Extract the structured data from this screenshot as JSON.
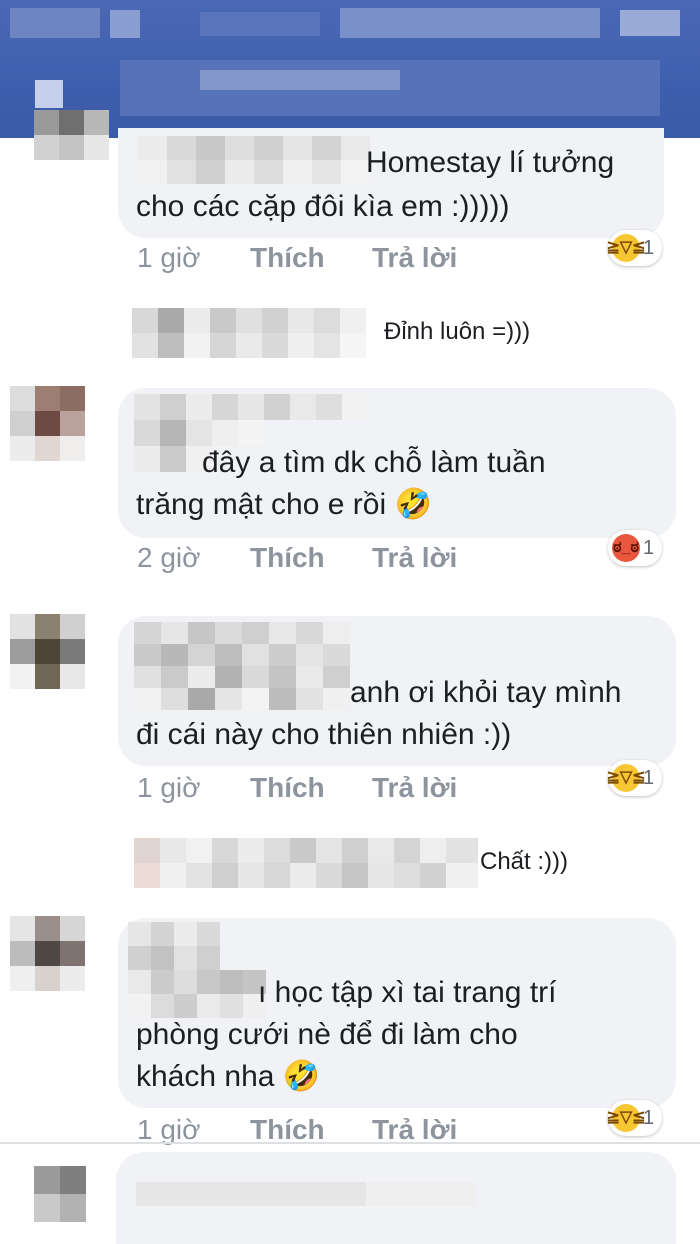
{
  "header": {
    "blurred": true
  },
  "comments": [
    {
      "id": "c1",
      "text_lines": [
        "Homestay lí tưởng",
        "cho các cặp đôi kìa em :)))))"
      ],
      "time": "1 giờ",
      "like_label": "Thích",
      "reply_label": "Trả lời",
      "reaction": {
        "type": "haha",
        "count": "1"
      }
    },
    {
      "id": "r1",
      "text": "Đỉnh luôn =)))"
    },
    {
      "id": "c2",
      "text_lines": [
        "đây a tìm dk chỗ làm tuần",
        "trăng mật cho e rồi 🤣"
      ],
      "time": "2 giờ",
      "like_label": "Thích",
      "reply_label": "Trả lời",
      "reaction": {
        "type": "angry",
        "count": "1"
      }
    },
    {
      "id": "c3",
      "text_lines": [
        "anh ơi khỏi tay mình",
        "đi cái này cho thiên nhiên :))"
      ],
      "time": "1 giờ",
      "like_label": "Thích",
      "reply_label": "Trả lời",
      "reaction": {
        "type": "haha",
        "count": "1"
      }
    },
    {
      "id": "r2",
      "text": "Chất :)))"
    },
    {
      "id": "c4",
      "text_lines": [
        "ı học tập xì tai trang trí",
        "phòng cưới nè để đi làm cho",
        "khách nha 🤣"
      ],
      "time": "1 giờ",
      "like_label": "Thích",
      "reply_label": "Trả lời",
      "reaction": {
        "type": "haha",
        "count": "1"
      }
    }
  ],
  "colors": {
    "header_blue": "#3f5fae",
    "bubble": "#f0f2f5",
    "meta_gray": "#8d949e",
    "haha_yellow": "#f7c633",
    "angry_red": "#e9573f"
  }
}
